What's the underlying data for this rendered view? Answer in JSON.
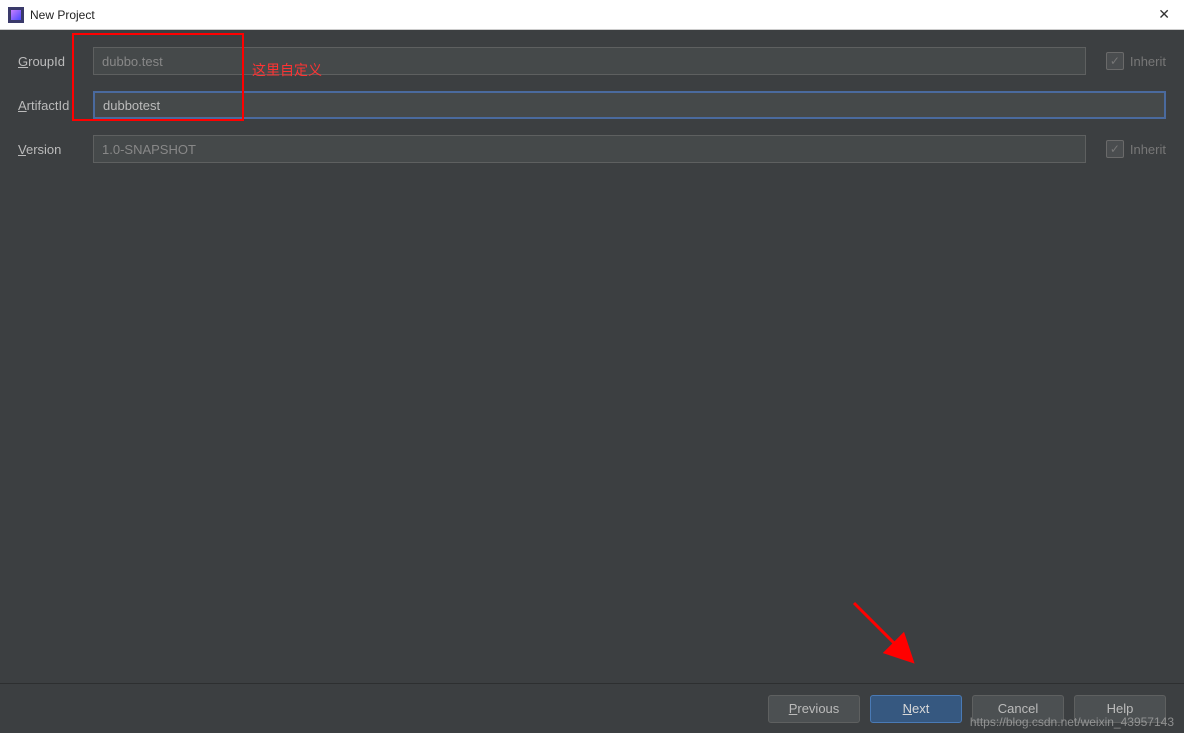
{
  "window": {
    "title": "New Project"
  },
  "form": {
    "groupId": {
      "label": "GroupId",
      "value": "dubbo.test",
      "inherit": {
        "label": "Inherit",
        "checked": true
      }
    },
    "artifactId": {
      "label": "ArtifactId",
      "value": "dubbotest"
    },
    "version": {
      "label": "Version",
      "value": "1.0-SNAPSHOT",
      "inherit": {
        "label": "Inherit",
        "checked": true
      }
    }
  },
  "annotation": {
    "text": "这里自定义"
  },
  "buttons": {
    "previous": "Previous",
    "next": "Next",
    "cancel": "Cancel",
    "help": "Help"
  },
  "watermark": "https://blog.csdn.net/weixin_43957143"
}
